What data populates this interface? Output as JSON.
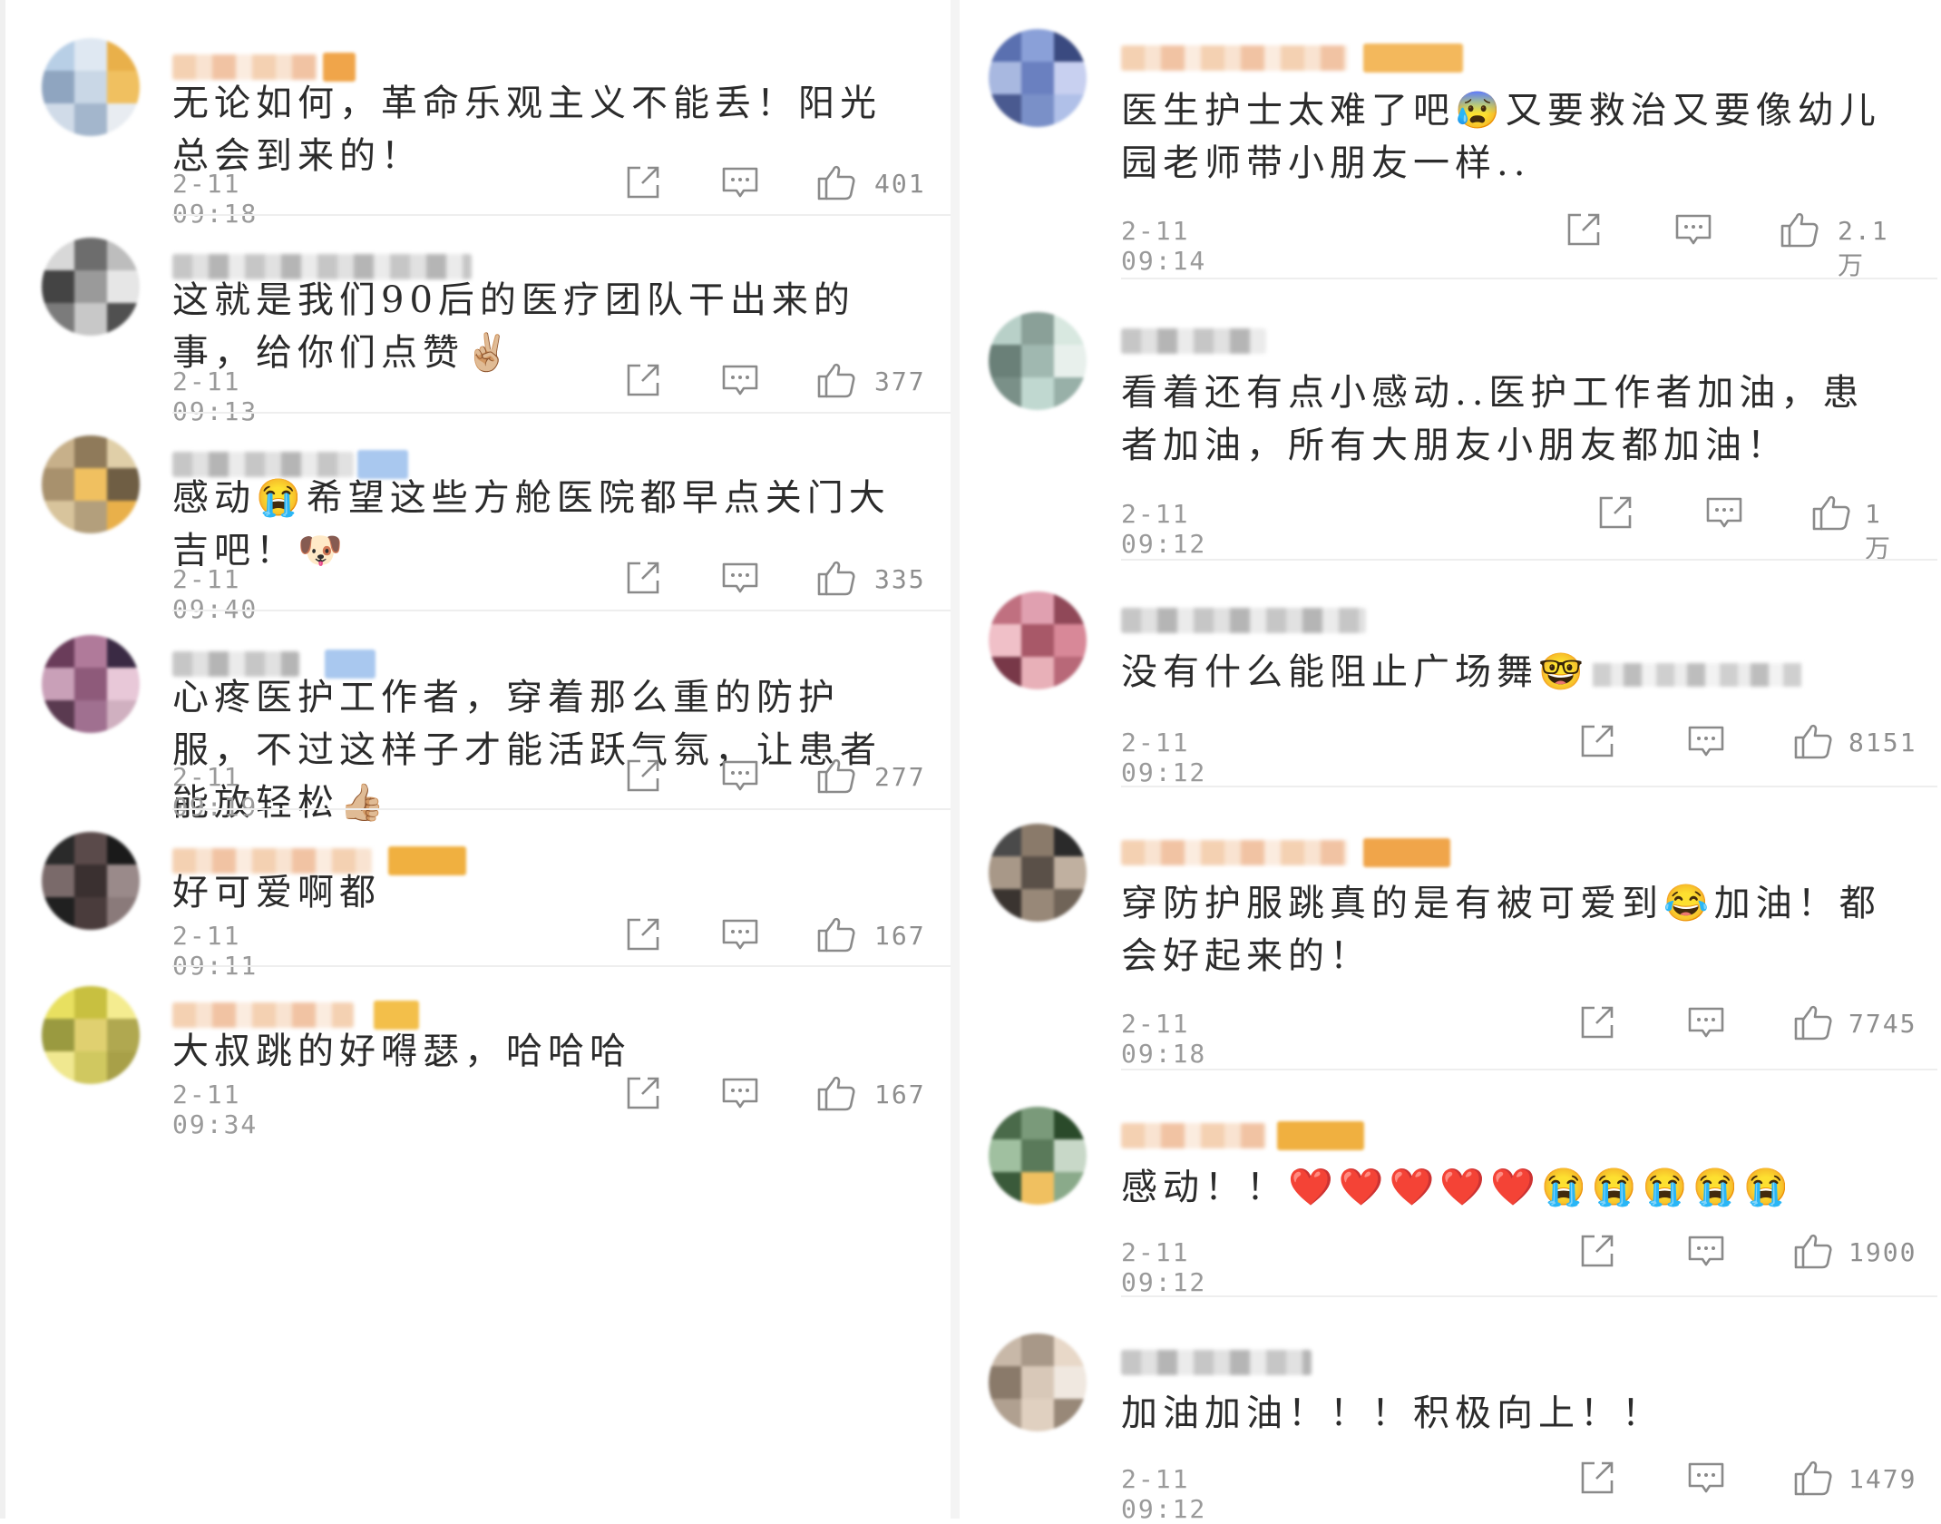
{
  "left_comments": [
    {
      "text": "无论如何，革命乐观主义不能丢！阳光总会到来的！",
      "time": "2-11 09:18",
      "likes": "401"
    },
    {
      "text": "这就是我们90后的医疗团队干出来的事，给你们点赞✌🏼",
      "time": "2-11 09:13",
      "likes": "377"
    },
    {
      "text": "感动😭希望这些方舱医院都早点关门大吉吧！🐶",
      "time": "2-11 09:40",
      "likes": "335"
    },
    {
      "text": "心疼医护工作者，穿着那么重的防护服，不过这样子才能活跃气氛，让患者能放轻松👍🏼",
      "time": "2-11 09:19",
      "likes": "277"
    },
    {
      "text": "好可爱啊都",
      "time": "2-11 09:11",
      "likes": "167"
    },
    {
      "text": "大叔跳的好嘚瑟，哈哈哈",
      "time": "2-11 09:34",
      "likes": "167"
    }
  ],
  "right_comments": [
    {
      "text": "医生护士太难了吧😰又要救治又要像幼儿园老师带小朋友一样..",
      "time": "2-11 09:14",
      "likes": "2.1万"
    },
    {
      "text": "看着还有点小感动..医护工作者加油，患者加油，所有大朋友小朋友都加油！",
      "time": "2-11 09:12",
      "likes": "1万"
    },
    {
      "text": "没有什么能阻止广场舞🤓",
      "time": "2-11 09:12",
      "likes": "8151"
    },
    {
      "text": "穿防护服跳真的是有被可爱到😂加油！都会好起来的！",
      "time": "2-11 09:18",
      "likes": "7745"
    },
    {
      "text": "感动！！❤️❤️❤️❤️❤️😭😭😭😭😭",
      "time": "2-11 09:12",
      "likes": "1900"
    },
    {
      "text": "加油加油！！！积极向上！！",
      "time": "2-11 09:12",
      "likes": "1479"
    }
  ],
  "icons": {
    "share": "share-icon",
    "comment": "comment-icon",
    "like": "thumbs-up-icon"
  },
  "colors": {
    "text": "#2b2b2b",
    "meta": "#9a9a9a",
    "icon": "#8a8a8a",
    "separator": "#eeeeee"
  }
}
